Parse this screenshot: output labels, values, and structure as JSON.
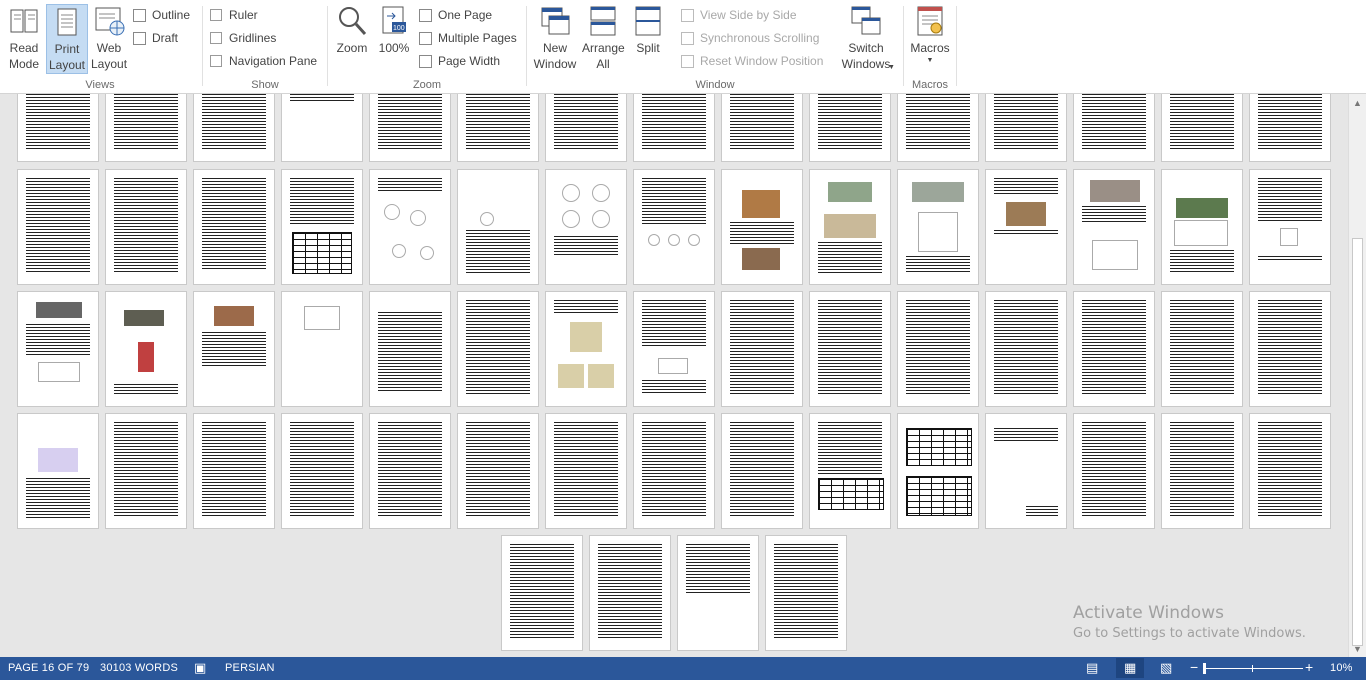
{
  "ribbon": {
    "views": {
      "label": "Views",
      "read_mode": "Read Mode",
      "print_layout": "Print Layout",
      "web_layout": "Web Layout",
      "outline": "Outline",
      "draft": "Draft"
    },
    "show": {
      "label": "Show",
      "ruler": "Ruler",
      "gridlines": "Gridlines",
      "navigation_pane": "Navigation Pane"
    },
    "zoom": {
      "label": "Zoom",
      "zoom": "Zoom",
      "percent": "100%",
      "one_page": "One Page",
      "multiple_pages": "Multiple Pages",
      "page_width": "Page Width"
    },
    "window": {
      "label": "Window",
      "new_window": "New Window",
      "arrange_all": "Arrange All",
      "split": "Split",
      "view_side_by_side": "View Side by Side",
      "synchronous_scrolling": "Synchronous Scrolling",
      "reset_window_position": "Reset Window Position",
      "switch_windows": "Switch Windows"
    },
    "macros": {
      "label": "Macros",
      "macros": "Macros"
    }
  },
  "status": {
    "page": "PAGE 16 OF 79",
    "words": "30103 WORDS",
    "language": "PERSIAN",
    "zoom": "10%"
  },
  "watermark": {
    "title": "Activate Windows",
    "subtitle": "Go to Settings to activate Windows."
  },
  "colors": {
    "status_bar": "#2b579a",
    "active_button": "#c5dcf3",
    "canvas": "#e6e6e6"
  }
}
